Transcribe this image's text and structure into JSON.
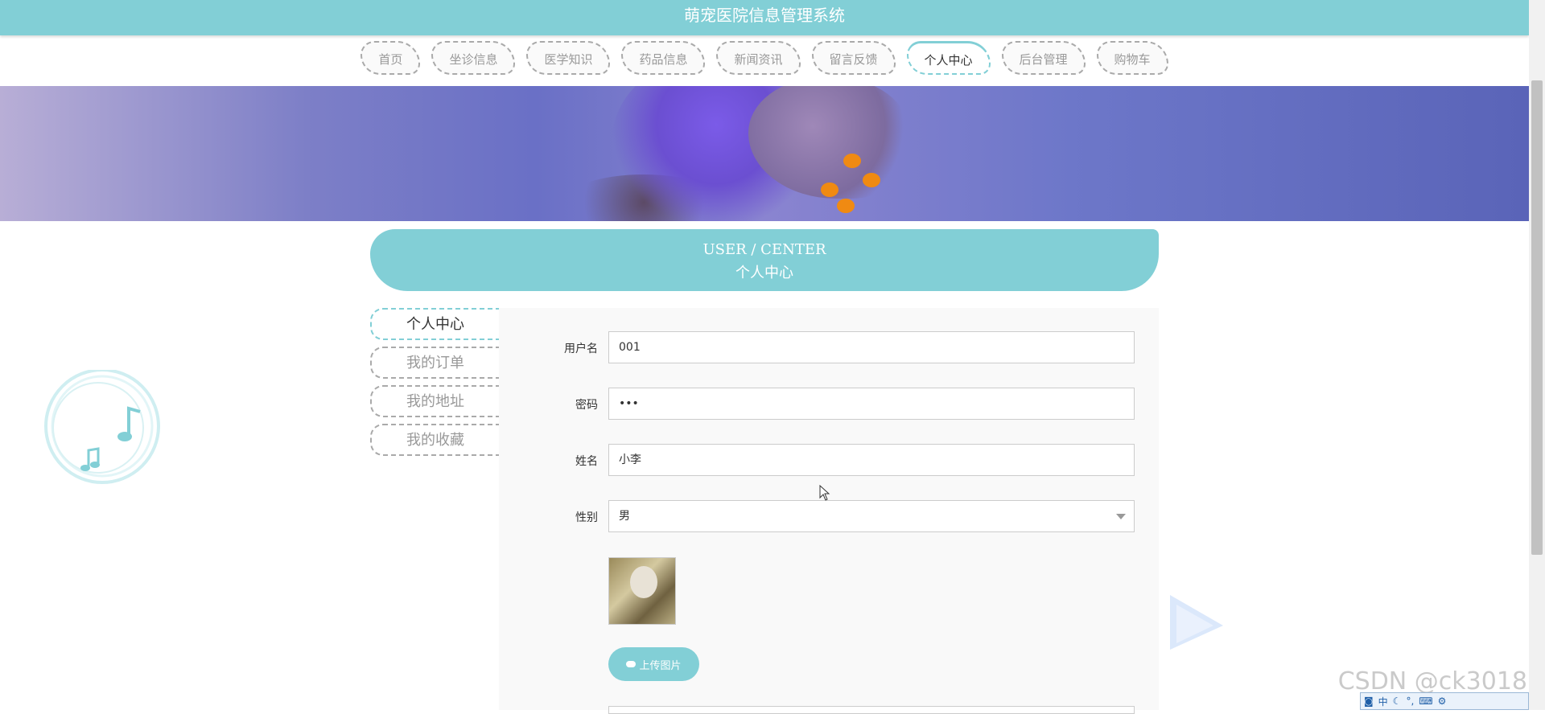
{
  "app": {
    "title": "萌宠医院信息管理系统"
  },
  "nav": {
    "items": [
      {
        "label": "首页"
      },
      {
        "label": "坐诊信息"
      },
      {
        "label": "医学知识"
      },
      {
        "label": "药品信息"
      },
      {
        "label": "新闻资讯"
      },
      {
        "label": "留言反馈"
      },
      {
        "label": "个人中心"
      },
      {
        "label": "后台管理"
      },
      {
        "label": "购物车"
      }
    ],
    "active": "个人中心"
  },
  "header": {
    "en": "USER / CENTER",
    "cn": "个人中心"
  },
  "sidebar": {
    "items": [
      {
        "label": "个人中心"
      },
      {
        "label": "我的订单"
      },
      {
        "label": "我的地址"
      },
      {
        "label": "我的收藏"
      }
    ]
  },
  "form": {
    "username": {
      "label": "用户名",
      "value": "001"
    },
    "password": {
      "label": "密码",
      "value": "•••"
    },
    "name": {
      "label": "姓名",
      "value": "小李"
    },
    "gender": {
      "label": "性别",
      "value": "男"
    },
    "upload_label": "上传图片"
  },
  "watermark": "CSDN @ck3018",
  "ime": {
    "text": "中"
  },
  "colors": {
    "accent": "#82cfd6"
  }
}
